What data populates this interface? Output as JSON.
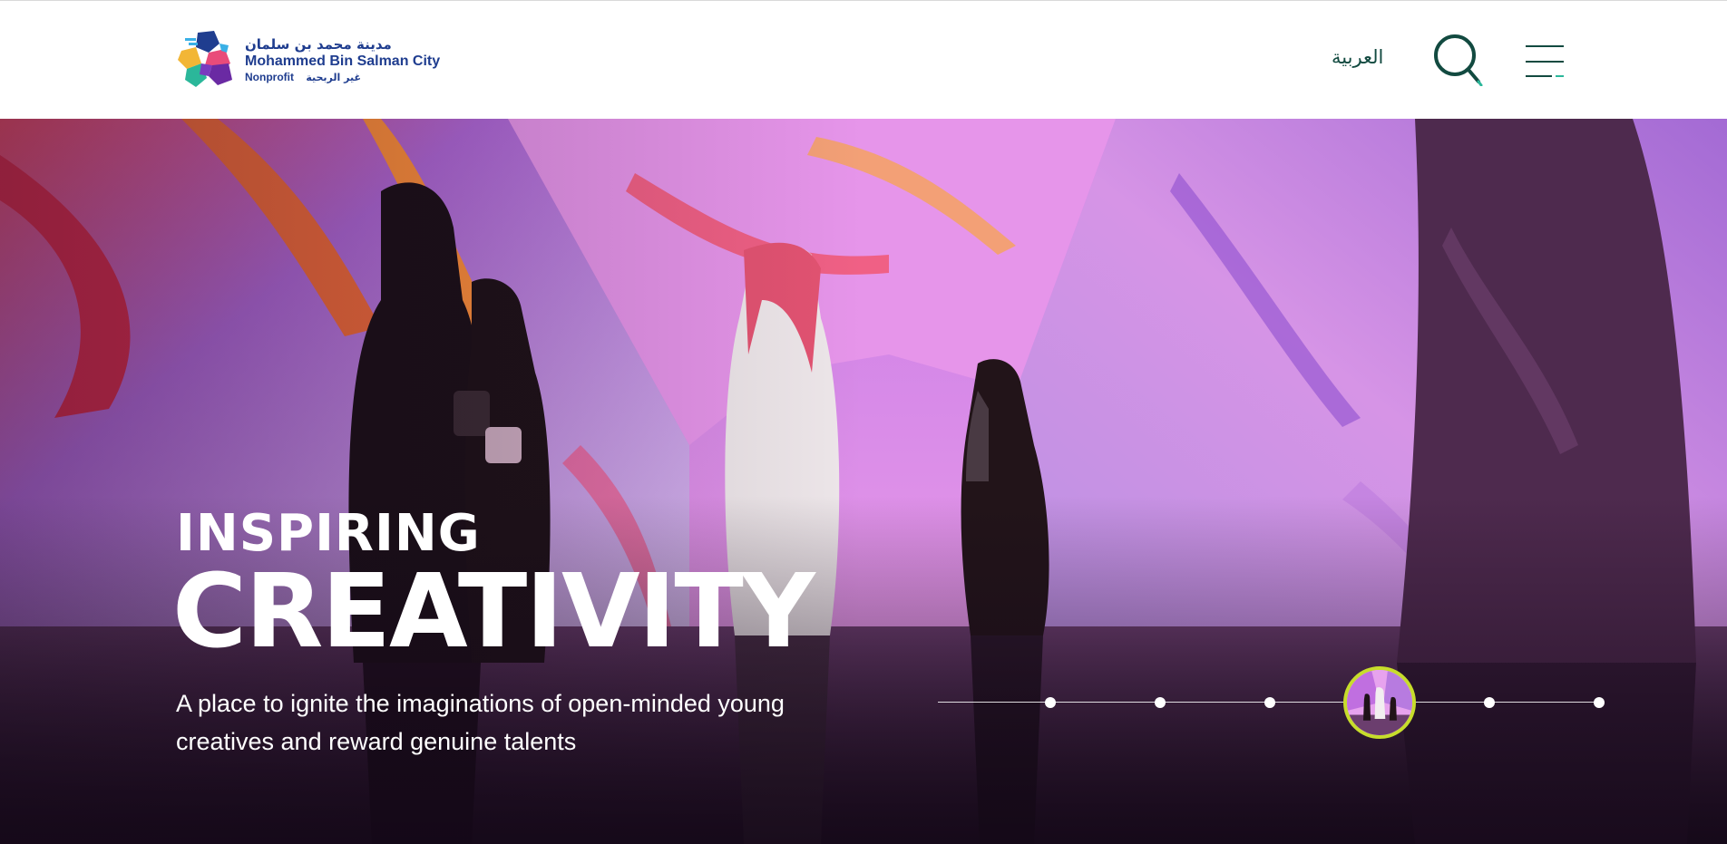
{
  "header": {
    "logo": {
      "name_ar": "مدينة محمد بن سلمان",
      "name_en": "Mohammed Bin Salman City",
      "tag_en": "Nonprofit",
      "tag_ar": "غير الربحية"
    },
    "language_link": "العربية",
    "search_icon": "search-icon",
    "menu_icon": "hamburger-menu-icon"
  },
  "hero": {
    "eyebrow": "INSPIRING",
    "title": "CREATIVITY",
    "description": "A place to ignite the imaginations of open-minded young creatives and reward genuine talents",
    "slider": {
      "total_slides": 6,
      "active_slide": 4
    }
  },
  "colors": {
    "brand_blue": "#1f3d8f",
    "brand_green": "#124a40",
    "slider_accent": "#c7dd2b",
    "hero_text": "#ffffff"
  }
}
